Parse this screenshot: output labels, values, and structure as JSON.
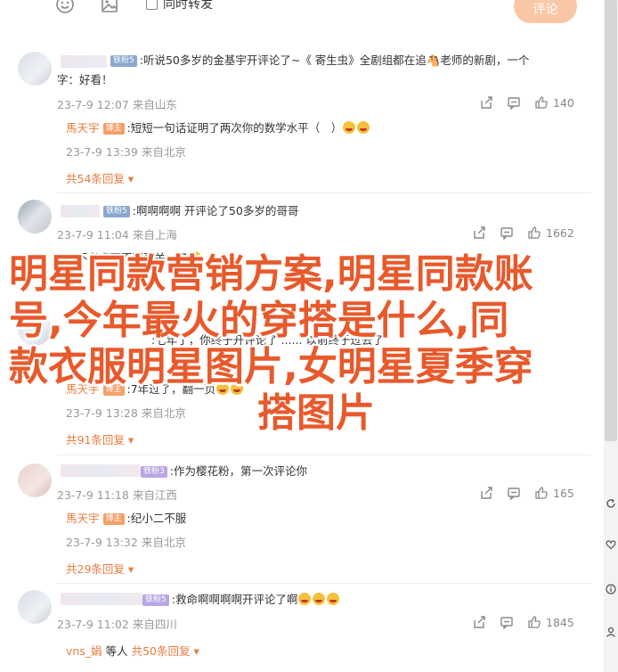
{
  "toolbar": {
    "repost_label": "同时转发",
    "submit_label": "评论"
  },
  "comments": [
    {
      "badge": "铁粉5",
      "text": ":听说50多岁的金基宇开评论了~《 寄生虫》全剧组都在追🐴老师的新剧，一个",
      "text2": "字：好看！",
      "date": "23-7-9 12:07",
      "source": "来自山东",
      "likes": "140",
      "replies": [
        {
          "name": "馬天宇",
          "badge": "博主",
          "text": ":短短一句话证明了两次你的数学水平（　）",
          "date": "23-7-9 13:39",
          "source": "来自北京"
        }
      ],
      "more": "共54条回复"
    },
    {
      "badge": "铁粉5",
      "text": ":啊啊啊啊 开评论了50多岁的哥哥",
      "date": "23-7-9 11:04",
      "source": "来自上海",
      "likes": "1662",
      "replies": [
        {
          "name": "",
          "badge": "",
          "text": "...不老虎更不要更关，了",
          "date": "",
          "source": ""
        }
      ],
      "more": ""
    },
    {
      "badge": "",
      "text": ":七年了，你终于开评论了 ...... 以前终于过去了",
      "date": "",
      "source": "",
      "likes": "",
      "replies": [
        {
          "name": "馬天宇",
          "badge": "博主",
          "text": ":7年过了，翻一页",
          "date": "23-7-9 13:28",
          "source": "来自北京"
        }
      ],
      "more": "共91条回复"
    },
    {
      "badge": "铁粉3",
      "text": ":作为樱花粉，第一次评论你",
      "date": "23-7-9 11:18",
      "source": "来自江西",
      "likes": "165",
      "replies": [
        {
          "name": "馬天宇",
          "badge": "博主",
          "text": ":纪小二不服",
          "date": "23-7-9 13:32",
          "source": "来自北京"
        }
      ],
      "more": "共29条回复"
    },
    {
      "badge": "铁粉5",
      "text": ":救命啊啊啊啊开评论了啊",
      "date": "23-7-9 11:02",
      "source": "来自四川",
      "likes": "1845",
      "replies": [],
      "more_prefix": "vns_娟",
      "more_mid": "等人",
      "more": "共50条回复"
    }
  ],
  "overlay": {
    "line1": "明星同款营销方案,明星同款账",
    "line2": "号,今年最火的穿搭是什么,同",
    "line3": "款衣服明星图片,女明星夏季穿",
    "line4": "搭图片"
  },
  "colors": {
    "accent": "#e87b3c",
    "headline": "#e8592b",
    "submit": "#f9c7a6"
  }
}
